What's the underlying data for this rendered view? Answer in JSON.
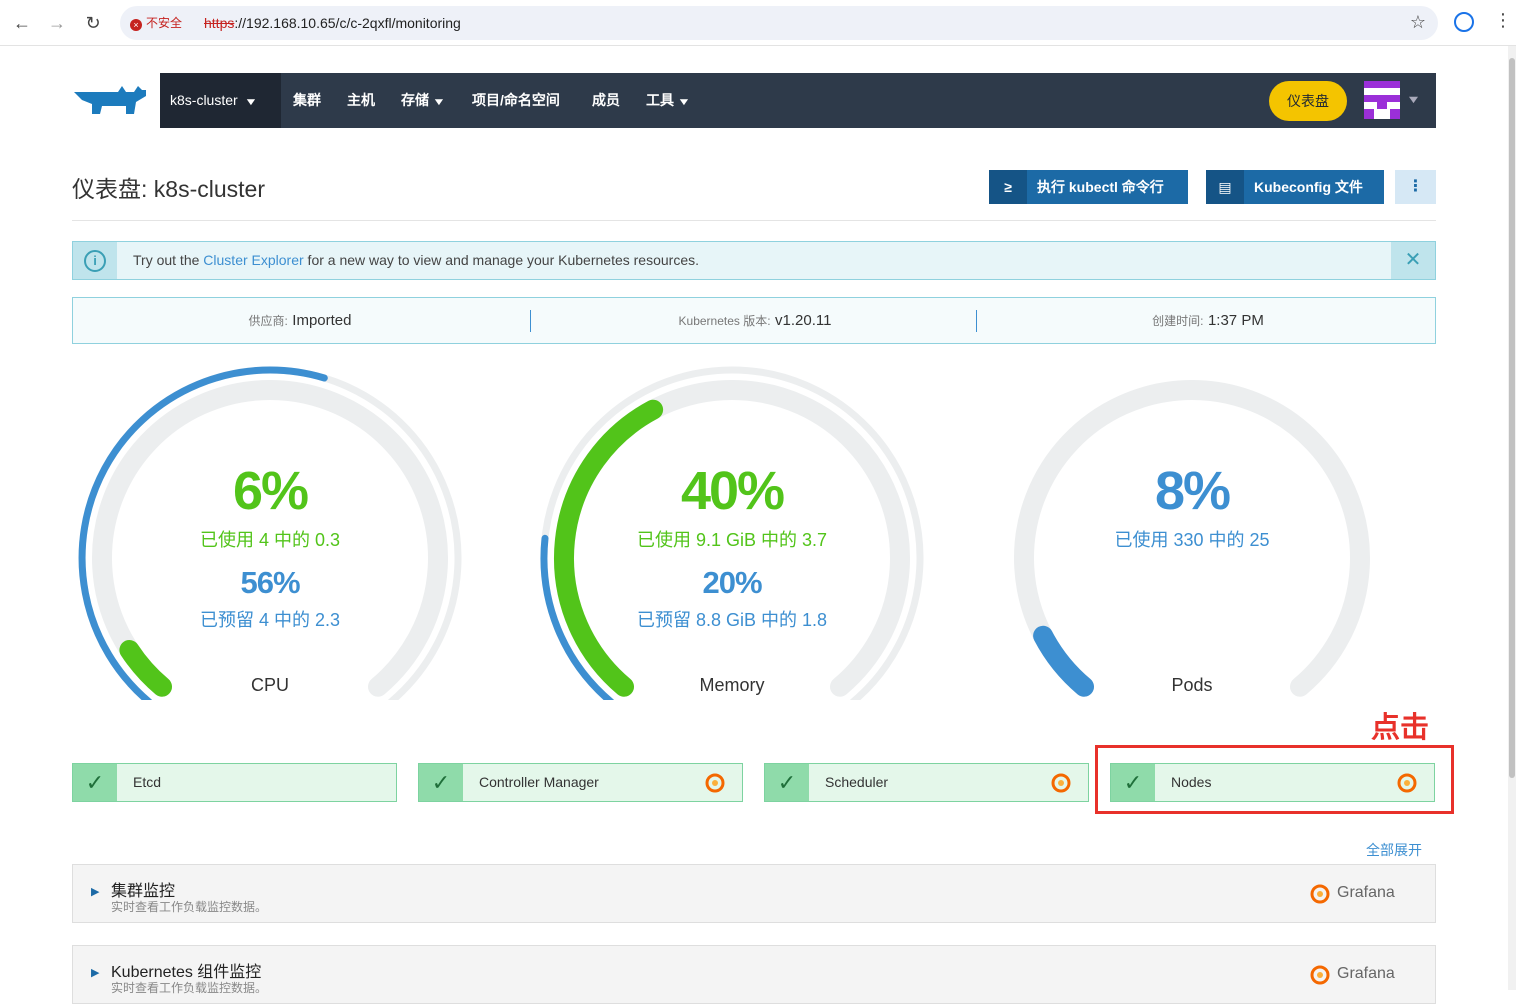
{
  "browser": {
    "security_label": "不安全",
    "url_scheme": "https",
    "url_rest": "://192.168.10.65/c/c-2qxfl/monitoring"
  },
  "header": {
    "cluster_selector": "k8s-cluster",
    "nav": [
      "集群",
      "主机",
      "存储",
      "项目/命名空间",
      "成员",
      "工具"
    ],
    "dashboard_button": "仪表盘"
  },
  "page": {
    "title": "仪表盘: k8s-cluster",
    "kubectl_button": "执行 kubectl 命令行",
    "kubeconfig_button": "Kubeconfig 文件"
  },
  "banner": {
    "text_before": "Try out the ",
    "link": "Cluster Explorer",
    "text_after": " for a new way to view and manage your Kubernetes resources."
  },
  "info": {
    "provider_label": "供应商:",
    "provider_value": "Imported",
    "k8s_version_label": "Kubernetes 版本:",
    "k8s_version_value": "v1.20.11",
    "created_label": "创建时间:",
    "created_value": "1:37 PM"
  },
  "gauges": {
    "cpu": {
      "used_percent": "6%",
      "used_text": "已使用  4  中的  0.3",
      "reserved_percent": "56%",
      "reserved_text": "已预留  4  中的  2.3",
      "label": "CPU",
      "used_fraction": 0.06,
      "reserved_fraction": 0.56
    },
    "memory": {
      "used_percent": "40%",
      "used_text": "已使用  9.1 GiB  中的  3.7",
      "reserved_percent": "20%",
      "reserved_text": "已预留  8.8 GiB  中的  1.8",
      "label": "Memory",
      "used_fraction": 0.4,
      "reserved_fraction": 0.2
    },
    "pods": {
      "used_percent": "8%",
      "used_text": "已使用  330  中的  25",
      "label": "Pods",
      "used_fraction": 0.08
    }
  },
  "annotation": "点击",
  "components": [
    "Etcd",
    "Controller Manager",
    "Scheduler",
    "Nodes"
  ],
  "expand_all": "全部展开",
  "sections": [
    {
      "title": "集群监控",
      "subtitle": "实时查看工作负载监控数据。",
      "grafana": "Grafana"
    },
    {
      "title": "Kubernetes 组件监控",
      "subtitle": "实时查看工作负载监控数据。",
      "grafana": "Grafana"
    }
  ],
  "colors": {
    "used": "#52c41a",
    "reserved": "#3d8fd1",
    "track": "#eceeef",
    "nav_bg": "#2e3a4a",
    "accent": "#f4c400"
  }
}
